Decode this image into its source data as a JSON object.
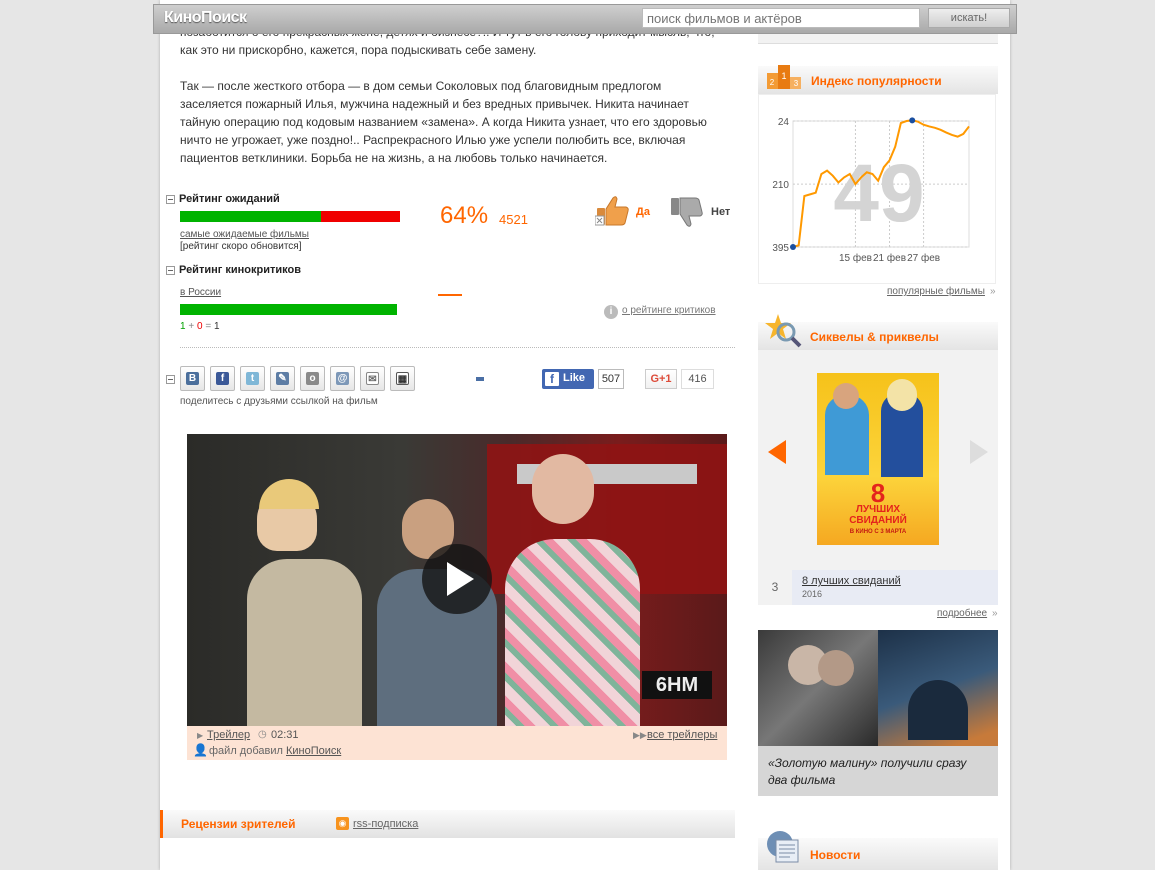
{
  "header": {
    "logo": "КиноПоиск",
    "search_placeholder": "поиск фильмов и актёров",
    "search_button": "искать!"
  },
  "description": {
    "line_top": "позаботится о его прекрасных жене, детях и бизнесе?.. И тут в его голову приходит мысль, что,",
    "line_top2": "как это ни прискорбно, кажется, пора подыскивать себе замену.",
    "p2": [
      "Так — после жесткого отбора — в дом семьи Соколовых под благовидным предлогом",
      "заселяется пожарный Илья, мужчина надежный и без вредных привычек. Никита начинает",
      "тайную операцию под кодовым названием «замена». А когда Никита узнает, что его здоровью",
      "ничто не угрожает, уже поздно!.. Распрекрасного Илью уже успели полюбить все, включая",
      "пациентов ветклиники. Борьба не на жизнь, а на любовь только начинается."
    ]
  },
  "expectations": {
    "title": "Рейтинг ожиданий",
    "percent": "64%",
    "votes": "4521",
    "yes_fraction": 0.64,
    "link": "самые ожидаемые фильмы",
    "note": "[рейтинг скоро обновится]",
    "yes_label": "Да",
    "no_label": "Нет"
  },
  "critics": {
    "title": "Рейтинг кинокритиков",
    "region": "в России",
    "positive_fraction": 1.0,
    "dash": "—",
    "formula": {
      "pos": "1",
      "plus": "+",
      "neg": "0",
      "eq": "=",
      "total": "1"
    },
    "about_link": "о рейтинге критиков"
  },
  "share": {
    "caption": "поделитесь с друзьями ссылкой на фильм",
    "fb_like": "Like",
    "fb_count": "507",
    "gplus_label": "G+1",
    "gplus_count": "416",
    "icons": [
      "vk-icon",
      "facebook-icon",
      "twitter-icon",
      "livejournal-icon",
      "odnoklassniki-icon",
      "moimir-icon",
      "email-icon",
      "qr-icon"
    ]
  },
  "video": {
    "trailer_label": "Трейлер",
    "duration": "02:31",
    "all_trailers": "все трейлеры",
    "added_by_prefix": "файл добавил",
    "added_by": "КиноПоиск",
    "plate": "6HM"
  },
  "reviews": {
    "title": "Рецензии зрителей",
    "rss": "rss-подписка"
  },
  "popularity": {
    "title": "Индекс популярности",
    "big_number": "49",
    "more": "популярные фильмы",
    "y_ticks": [
      "24",
      "210",
      "395"
    ],
    "x_ticks": [
      "15 фев",
      "21 фев",
      "27 фев"
    ]
  },
  "chart_data": {
    "type": "line",
    "title": "Индекс популярности",
    "x": [
      1,
      2,
      3,
      4,
      5,
      6,
      7,
      8,
      9,
      10,
      11,
      12,
      13,
      14,
      15,
      16,
      17,
      18,
      19,
      20,
      21,
      22,
      23,
      24,
      25,
      26,
      27,
      28,
      29,
      30,
      31,
      32
    ],
    "values": [
      395,
      390,
      245,
      240,
      235,
      180,
      170,
      185,
      205,
      190,
      180,
      210,
      190,
      175,
      180,
      200,
      160,
      140,
      100,
      30,
      24,
      22,
      26,
      35,
      40,
      44,
      50,
      58,
      65,
      70,
      62,
      40
    ],
    "ylim": [
      395,
      24
    ],
    "y_ticks": [
      24,
      210,
      395
    ],
    "x_tick_labels": [
      "15 фев",
      "21 фев",
      "27 фев"
    ],
    "grid": true,
    "color": "#f90"
  },
  "sequels": {
    "title": "Сиквелы & приквелы",
    "poster_title_big": "8",
    "poster_title_line1": "ЛУЧШИХ",
    "poster_title_line2": "СВИДАНИЙ",
    "poster_release": "В КИНО С 3 МАРТА",
    "index": "3",
    "film_title": "8 лучших свиданий",
    "film_year": "2016",
    "more": "подробнее"
  },
  "promo": {
    "caption_line1": "«Золотую малину» получили сразу",
    "caption_line2": "два фильма"
  },
  "news": {
    "title": "Новости"
  },
  "colors": {
    "accent": "#ff6600",
    "green": "#00b300",
    "red": "#f00000"
  }
}
